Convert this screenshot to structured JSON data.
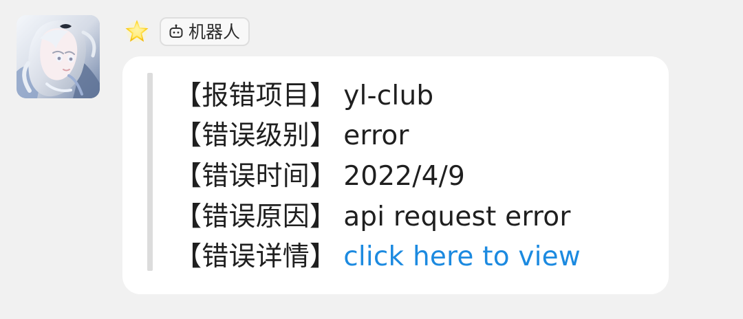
{
  "sender": {
    "avatar_icon": "anime-character-avatar",
    "badge_label": "机器人",
    "badge_icon": "robot-icon",
    "status_icon": "star-icon"
  },
  "message": {
    "rows": [
      {
        "label": "【报错项目】",
        "value": "yl-club",
        "is_link": false
      },
      {
        "label": "【错误级别】",
        "value": "error",
        "is_link": false
      },
      {
        "label": "【错误时间】",
        "value": "2022/4/9",
        "is_link": false
      },
      {
        "label": "【错误原因】",
        "value": "api request error",
        "is_link": false
      },
      {
        "label": "【错误详情】",
        "value": "click here to view",
        "is_link": true
      }
    ]
  },
  "colors": {
    "background": "#f1f1f1",
    "bubble": "#ffffff",
    "quote_bar": "#dcdcdc",
    "text": "#1f1f1f",
    "link": "#1c8ae0"
  }
}
